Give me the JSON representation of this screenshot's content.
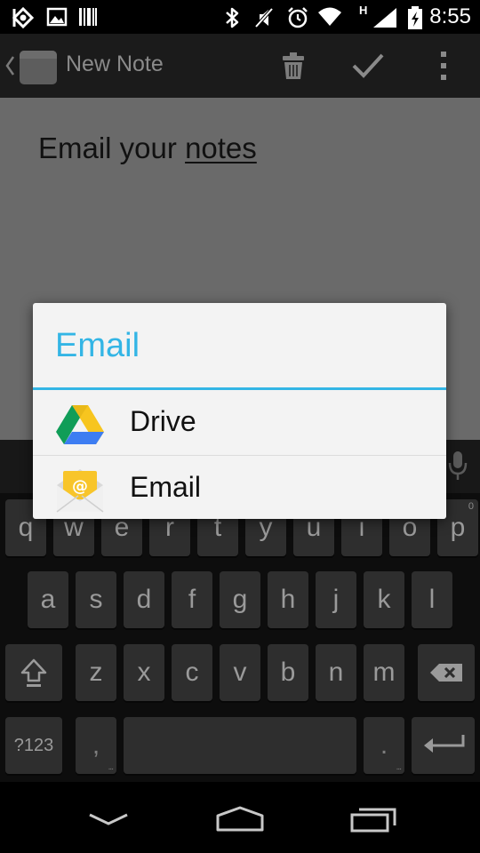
{
  "status_bar": {
    "time": "8:55",
    "left_icons": [
      "signal-hub-icon",
      "image-icon",
      "barcode-icon"
    ],
    "right_icons": [
      "bluetooth-icon",
      "mute-icon",
      "alarm-icon",
      "wifi-icon",
      "cell-signal-icon",
      "battery-charging-icon"
    ],
    "network_label": "H"
  },
  "action_bar": {
    "title": "New Note",
    "actions": [
      "trash-icon",
      "check-icon",
      "overflow-menu-icon"
    ]
  },
  "note": {
    "text_prefix": "Email your ",
    "text_underlined": "notes"
  },
  "dialog": {
    "title": "Email",
    "items": [
      {
        "label": "Drive",
        "icon": "drive-icon"
      },
      {
        "label": "Email",
        "icon": "email-app-icon"
      }
    ],
    "accent_color": "#33b5e5"
  },
  "keyboard": {
    "row1": [
      {
        "key": "q",
        "hint": ""
      },
      {
        "key": "w",
        "hint": ""
      },
      {
        "key": "e",
        "hint": ""
      },
      {
        "key": "r",
        "hint": ""
      },
      {
        "key": "t",
        "hint": ""
      },
      {
        "key": "y",
        "hint": ""
      },
      {
        "key": "u",
        "hint": ""
      },
      {
        "key": "i",
        "hint": ""
      },
      {
        "key": "o",
        "hint": ""
      },
      {
        "key": "p",
        "hint": "0"
      }
    ],
    "row2": [
      "a",
      "s",
      "d",
      "f",
      "g",
      "h",
      "j",
      "k",
      "l"
    ],
    "row3": [
      "z",
      "x",
      "c",
      "v",
      "b",
      "n",
      "m"
    ],
    "symbols_key": "?123",
    "comma_key": ",",
    "period_key": ".",
    "icons": [
      "shift-icon",
      "backspace-icon",
      "enter-icon",
      "microphone-icon"
    ]
  },
  "nav_bar": {
    "buttons": [
      "back-down-icon",
      "home-icon",
      "recents-icon"
    ]
  }
}
